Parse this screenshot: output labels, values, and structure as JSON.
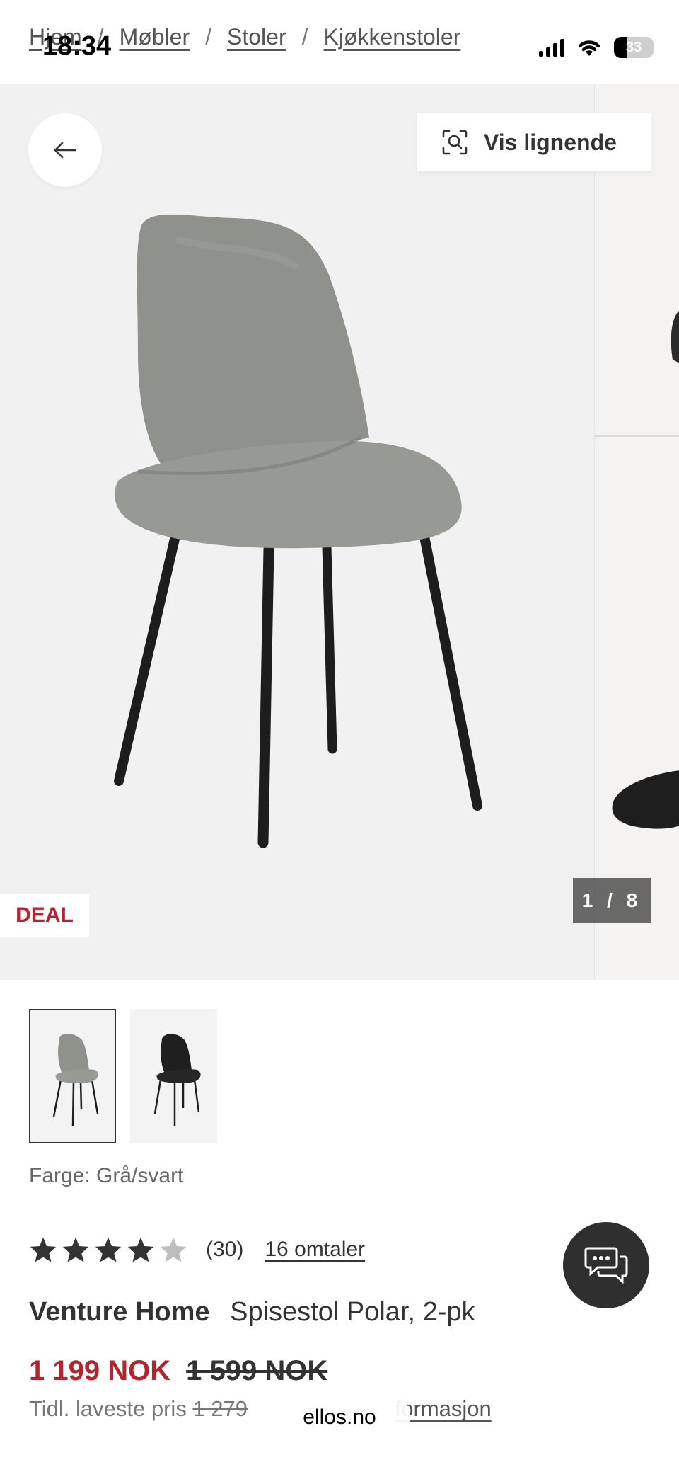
{
  "status_bar": {
    "time": "18:34",
    "battery": "33"
  },
  "breadcrumb": [
    "Hjem",
    "Møbler",
    "Stoler",
    "Kjøkkenstoler"
  ],
  "breadcrumb_separator": "/",
  "gallery": {
    "vis_lignende": "Vis lignende",
    "badge": "DEAL",
    "counter": "1 / 8",
    "colors": {
      "background": "#f1f1f1",
      "chair_fabric": "#8f928c",
      "chair_legs": "#1d1d1d"
    }
  },
  "thumbnails": [
    {
      "name": "grey",
      "selected": true
    },
    {
      "name": "black",
      "selected": false
    }
  ],
  "color_label": "Farge: Grå/svart",
  "rating": {
    "stars_filled": 4,
    "stars_total": 5,
    "count": "(30)",
    "reviews_link": "16 omtaler"
  },
  "product": {
    "brand": "Venture Home",
    "name": "Spisestol Polar, 2-pk"
  },
  "price": {
    "current": "1 199 NOK",
    "previous": "1 599 NOK"
  },
  "lowest_price": {
    "label": "Tidl. laveste pris",
    "value": "1 279",
    "info_link": "formasjon"
  },
  "url_pill": "ellos.no",
  "accent_color": "#b2242f"
}
